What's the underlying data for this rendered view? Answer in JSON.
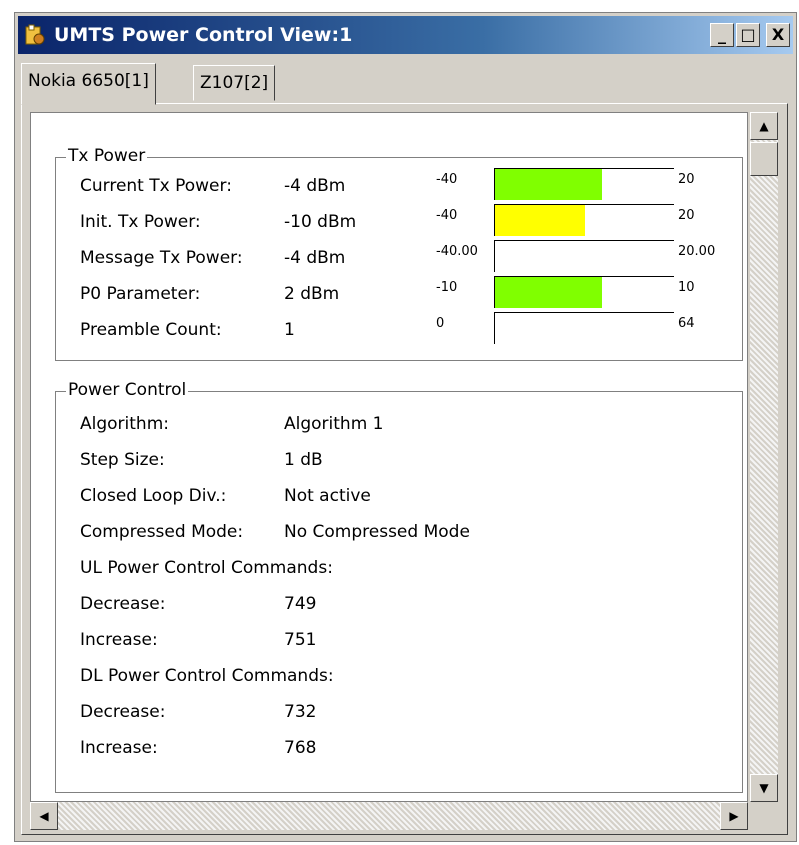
{
  "window": {
    "title": "UMTS Power Control View:1",
    "buttons": {
      "minimize": "_",
      "maximize": "□",
      "close": "X"
    }
  },
  "tabs": [
    {
      "label": "Nokia 6650[1]",
      "active": true
    },
    {
      "label": "Z107[2]",
      "active": false
    }
  ],
  "tx_power": {
    "title": "Tx Power",
    "rows": [
      {
        "label": "Current Tx Power:",
        "value": "-4 dBm",
        "min": "-40",
        "max": "20",
        "fill_fraction": 0.6,
        "color": "#80ff00"
      },
      {
        "label": "Init. Tx Power:",
        "value": "-10 dBm",
        "min": "-40",
        "max": "20",
        "fill_fraction": 0.5,
        "color": "#ffff00"
      },
      {
        "label": "Message Tx Power:",
        "value": "-4 dBm",
        "min": "-40.00",
        "max": "20.00",
        "fill_fraction": 0.0,
        "color": "#80ff00"
      },
      {
        "label": "P0 Parameter:",
        "value": "2 dBm",
        "min": "-10",
        "max": "10",
        "fill_fraction": 0.6,
        "color": "#80ff00"
      },
      {
        "label": "Preamble Count:",
        "value": "1",
        "min": "0",
        "max": "64",
        "fill_fraction": 0.0,
        "color": "#80ff00"
      }
    ]
  },
  "power_control": {
    "title": "Power Control",
    "rows": [
      {
        "label": "Algorithm:",
        "value": "Algorithm 1"
      },
      {
        "label": "Step Size:",
        "value": "1 dB"
      },
      {
        "label": "Closed Loop Div.:",
        "value": "Not active"
      },
      {
        "label": "Compressed Mode:",
        "value": "No Compressed Mode"
      },
      {
        "label": "UL Power Control Commands:",
        "value": ""
      },
      {
        "label": "Decrease:",
        "value": "749"
      },
      {
        "label": "Increase:",
        "value": "751"
      },
      {
        "label": "DL Power Control Commands:",
        "value": ""
      },
      {
        "label": "Decrease:",
        "value": "732"
      },
      {
        "label": "Increase:",
        "value": "768"
      }
    ]
  },
  "scrollbars": {
    "up": "▲",
    "down": "▼",
    "left": "◀",
    "right": "▶"
  }
}
